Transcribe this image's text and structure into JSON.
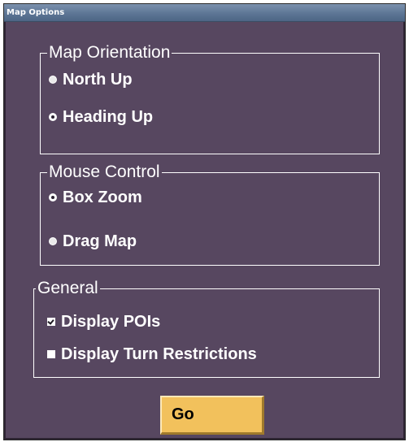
{
  "window": {
    "title": "Map Options"
  },
  "map_orientation": {
    "legend": "Map Orientation",
    "options": [
      {
        "label": "North Up",
        "selected": false
      },
      {
        "label": "Heading Up",
        "selected": true
      }
    ]
  },
  "mouse_control": {
    "legend": "Mouse Control",
    "options": [
      {
        "label": "Box Zoom",
        "selected": true
      },
      {
        "label": "Drag Map",
        "selected": false
      }
    ]
  },
  "general": {
    "legend": "General",
    "checkboxes": [
      {
        "label": "Display POIs",
        "checked": true
      },
      {
        "label": "Display Turn Restrictions",
        "checked": false
      }
    ]
  },
  "actions": {
    "go_label": "Go"
  },
  "colors": {
    "panel_background": "#574760",
    "title_bar": "#5d7695",
    "go_button": "#f2c15c",
    "text": "#ffffff"
  }
}
